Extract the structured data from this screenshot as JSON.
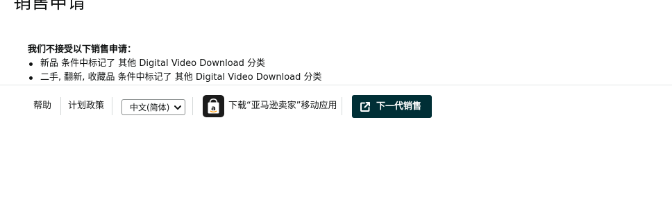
{
  "page": {
    "title": "销售申请"
  },
  "notice": {
    "heading": "我们不接受以下销售申请：",
    "items": [
      "新品 条件中标记了 其他 Digital Video Download 分类",
      "二手, 翻新, 收藏品 条件中标记了 其他 Digital Video Download 分类"
    ]
  },
  "footer": {
    "help_link": "帮助",
    "policy_link": "计划政策",
    "language_select": {
      "selected": "中文(简体)"
    },
    "app_download": {
      "icon": "amazon-seller-app-icon",
      "label": "下载“亚马逊卖家”移动应用"
    },
    "next_gen_button": {
      "icon": "external-link-icon",
      "label": "下一代销售"
    }
  },
  "colors": {
    "text": "#0f1111",
    "button_background": "#002f36",
    "button_text": "#ffffff",
    "divider": "#d5d9d9",
    "app_icon_background": "#1b1b1b"
  }
}
